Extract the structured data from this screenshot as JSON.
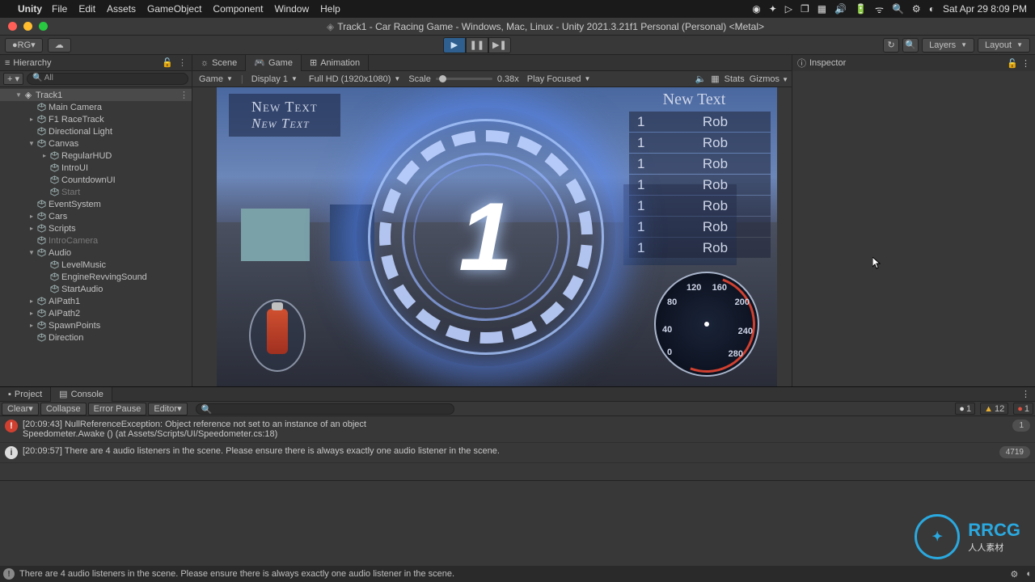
{
  "mac": {
    "app": "Unity",
    "menus": [
      "File",
      "Edit",
      "Assets",
      "GameObject",
      "Component",
      "Window",
      "Help"
    ],
    "clock": "Sat Apr 29  8:09 PM"
  },
  "window_title": "Track1 - Car Racing Game - Windows, Mac, Linux - Unity 2021.3.21f1 Personal (Personal) <Metal>",
  "toolbar": {
    "account": "RG",
    "layers": "Layers",
    "layout": "Layout"
  },
  "hierarchy": {
    "title": "Hierarchy",
    "search_placeholder": "All",
    "root": "Track1",
    "tree": [
      {
        "label": "Main Camera",
        "depth": 2
      },
      {
        "label": "F1 RaceTrack",
        "depth": 2,
        "exp": true
      },
      {
        "label": "Directional Light",
        "depth": 2
      },
      {
        "label": "Canvas",
        "depth": 2,
        "exp": true,
        "open": true
      },
      {
        "label": "RegularHUD",
        "depth": 3,
        "exp": true
      },
      {
        "label": "IntroUI",
        "depth": 3
      },
      {
        "label": "CountdownUI",
        "depth": 3
      },
      {
        "label": "Start",
        "depth": 3,
        "dim": true
      },
      {
        "label": "EventSystem",
        "depth": 2
      },
      {
        "label": "Cars",
        "depth": 2,
        "exp": true
      },
      {
        "label": "Scripts",
        "depth": 2,
        "exp": true
      },
      {
        "label": "IntroCamera",
        "depth": 2,
        "dim": true
      },
      {
        "label": "Audio",
        "depth": 2,
        "exp": true,
        "open": true
      },
      {
        "label": "LevelMusic",
        "depth": 3
      },
      {
        "label": "EngineRevvingSound",
        "depth": 3
      },
      {
        "label": "StartAudio",
        "depth": 3
      },
      {
        "label": "AIPath1",
        "depth": 2,
        "exp": true
      },
      {
        "label": "AIPath2",
        "depth": 2,
        "exp": true
      },
      {
        "label": "SpawnPoints",
        "depth": 2,
        "exp": true
      },
      {
        "label": "Direction",
        "depth": 2
      }
    ]
  },
  "game": {
    "tabs": {
      "scene": "Scene",
      "game": "Game",
      "animation": "Animation"
    },
    "dropdowns": {
      "mode": "Game",
      "display": "Display 1",
      "res": "Full HD (1920x1080)",
      "focus": "Play Focused"
    },
    "scale_label": "Scale",
    "scale_value": "0.38x",
    "r": {
      "stats": "Stats",
      "gizmos": "Gizmos"
    },
    "hud": {
      "line1": "New Text",
      "line2": "New Text"
    },
    "leaderboard": {
      "title": "New Text",
      "rows": [
        {
          "rank": "1",
          "name": "Rob"
        },
        {
          "rank": "1",
          "name": "Rob"
        },
        {
          "rank": "1",
          "name": "Rob"
        },
        {
          "rank": "1",
          "name": "Rob"
        },
        {
          "rank": "1",
          "name": "Rob"
        },
        {
          "rank": "1",
          "name": "Rob"
        },
        {
          "rank": "1",
          "name": "Rob"
        }
      ]
    },
    "countdown": "1",
    "speedo": {
      "t0": "0",
      "t40": "40",
      "t80": "80",
      "t120": "120",
      "t160": "160",
      "t200": "200",
      "t240": "240",
      "t280": "280"
    }
  },
  "inspector": {
    "title": "Inspector"
  },
  "console": {
    "tabs": {
      "project": "Project",
      "console": "Console"
    },
    "btns": {
      "clear": "Clear",
      "collapse": "Collapse",
      "error_pause": "Error Pause",
      "editor": "Editor"
    },
    "counts": {
      "info": "1",
      "warn": "12",
      "err": "1"
    },
    "logs": [
      {
        "type": "err",
        "time": "[20:09:43]",
        "msg": "NullReferenceException: Object reference not set to an instance of an object",
        "stack": "Speedometer.Awake () (at Assets/Scripts/UI/Speedometer.cs:18)",
        "count": "1"
      },
      {
        "type": "info",
        "time": "[20:09:57]",
        "msg": "There are 4 audio listeners in the scene. Please ensure there is always exactly one audio listener in the scene.",
        "count": "4719"
      }
    ]
  },
  "status": "There are 4 audio listeners in the scene. Please ensure there is always exactly one audio listener in the scene.",
  "watermark": {
    "brand": "RRCG",
    "sub": "人人素材"
  }
}
